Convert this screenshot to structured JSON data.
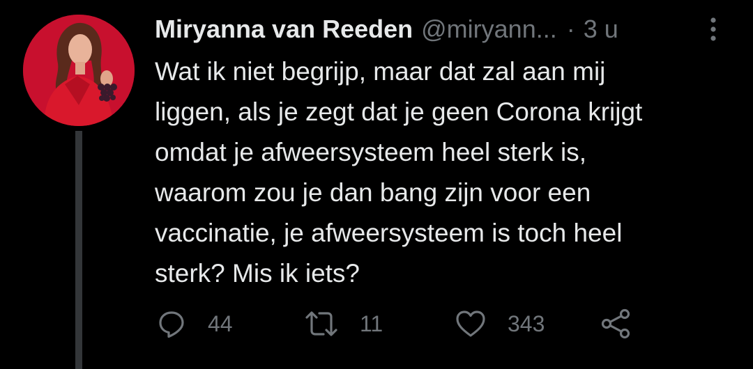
{
  "avatar": {
    "background": "#c8102e",
    "icon": "profile-photo"
  },
  "tweet": {
    "display_name": "Miryanna van Reeden",
    "handle": "@miryann...",
    "separator": "·",
    "time": "3 u",
    "text": "Wat ik niet begrijp, maar dat zal aan mij\nliggen, als je zegt dat je geen Corona krijgt\nomdat je afweersysteem heel sterk is,\nwaarom zou je dan bang zijn voor een\nvaccinatie, je afweersysteem is toch heel\nsterk? Mis ik iets?"
  },
  "actions": {
    "reply": {
      "icon": "reply-icon",
      "count": "44"
    },
    "retweet": {
      "icon": "retweet-icon",
      "count": "11"
    },
    "like": {
      "icon": "heart-icon",
      "count": "343"
    },
    "share": {
      "icon": "share-icon"
    }
  },
  "colors": {
    "background": "#000000",
    "text_primary": "#e7e9ea",
    "text_secondary": "#71767b",
    "thread_line": "#333639"
  }
}
